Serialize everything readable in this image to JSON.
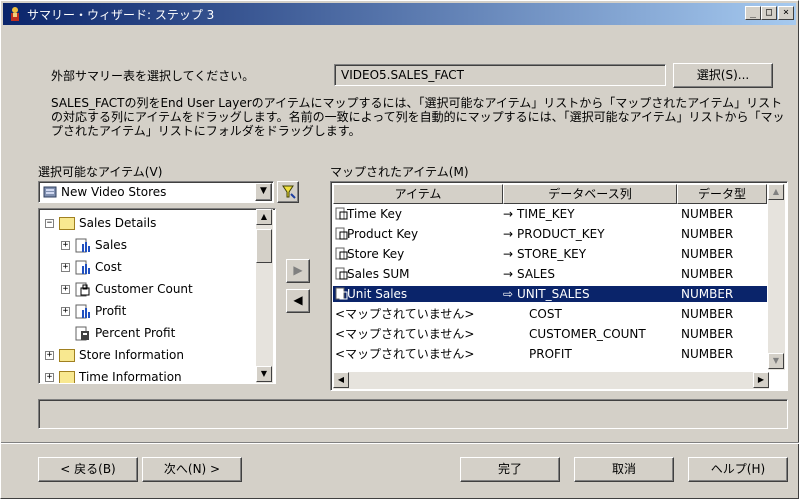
{
  "window": {
    "title": "サマリー・ウィザード: ステップ 3"
  },
  "summary_prompt": "外部サマリー表を選択してください。",
  "summary_table": "VIDEO5.SALES_FACT",
  "select_button": "選択(S)...",
  "description": "SALES_FACTの列をEnd User Layerのアイテムにマップするには、「選択可能なアイテム」リストから「マップされたアイテム」リストの対応する列にアイテムをドラッグします。名前の一致によって列を自動的にマップするには、「選択可能なアイテム」リストから「マップされたアイテム」リストにフォルダをドラッグします。",
  "available": {
    "label": "選択可能なアイテム(V)",
    "combo_value": "New Video Stores",
    "tree": [
      {
        "label": "Sales Details",
        "type": "folder",
        "level": 0,
        "expanded": true
      },
      {
        "label": "Sales",
        "type": "measure",
        "level": 1
      },
      {
        "label": "Cost",
        "type": "measure",
        "level": 1
      },
      {
        "label": "Customer Count",
        "type": "measure",
        "level": 1
      },
      {
        "label": "Profit",
        "type": "measure",
        "level": 1
      },
      {
        "label": "Percent Profit",
        "type": "calc",
        "level": 1
      },
      {
        "label": "Store Information",
        "type": "folder",
        "level": 0,
        "expanded": false
      },
      {
        "label": "Time Information",
        "type": "folder",
        "level": 0,
        "expanded": false
      }
    ]
  },
  "mapped": {
    "label": "マップされたアイテム(M)",
    "headers": [
      "アイテム",
      "データベース列",
      "データ型"
    ],
    "rows": [
      {
        "item": "Time Key",
        "column": "TIME_KEY",
        "type": "NUMBER",
        "arrow": "→",
        "selected": false
      },
      {
        "item": "Product Key",
        "column": "PRODUCT_KEY",
        "type": "NUMBER",
        "arrow": "→",
        "selected": false
      },
      {
        "item": "Store Key",
        "column": "STORE_KEY",
        "type": "NUMBER",
        "arrow": "→",
        "selected": false
      },
      {
        "item": "Sales SUM",
        "column": "SALES",
        "type": "NUMBER",
        "arrow": "→",
        "selected": false
      },
      {
        "item": "Unit Sales",
        "column": "UNIT_SALES",
        "type": "NUMBER",
        "arrow": "⇨",
        "selected": true
      },
      {
        "item": "<マップされていません>",
        "column": "COST",
        "type": "NUMBER",
        "arrow": "",
        "selected": false
      },
      {
        "item": "<マップされていません>",
        "column": "CUSTOMER_COUNT",
        "type": "NUMBER",
        "arrow": "",
        "selected": false
      },
      {
        "item": "<マップされていません>",
        "column": "PROFIT",
        "type": "NUMBER",
        "arrow": "",
        "selected": false
      }
    ]
  },
  "buttons": {
    "back": "< 戻る(B)",
    "next": "次へ(N) >",
    "finish": "完了",
    "cancel": "取消",
    "help": "ヘルプ(H)"
  },
  "colors": {
    "selection": "#0a246a",
    "face": "#d4d0c8",
    "title_start": "#0a246a",
    "title_end": "#a6caf0"
  }
}
